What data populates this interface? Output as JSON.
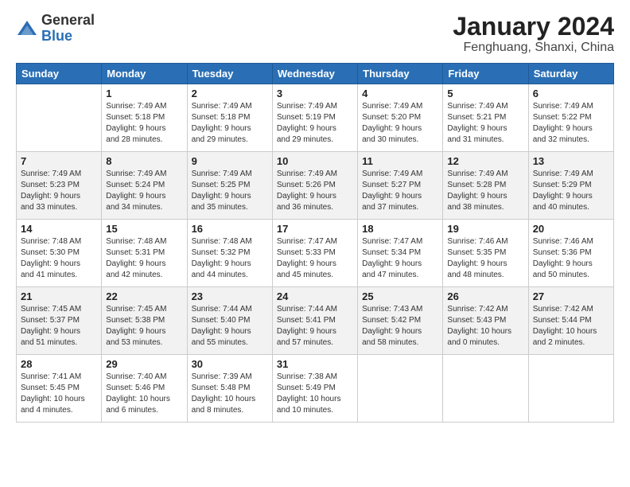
{
  "logo": {
    "general": "General",
    "blue": "Blue"
  },
  "title": {
    "month": "January 2024",
    "location": "Fenghuang, Shanxi, China"
  },
  "headers": [
    "Sunday",
    "Monday",
    "Tuesday",
    "Wednesday",
    "Thursday",
    "Friday",
    "Saturday"
  ],
  "weeks": [
    [
      {
        "day": "",
        "info": ""
      },
      {
        "day": "1",
        "info": "Sunrise: 7:49 AM\nSunset: 5:18 PM\nDaylight: 9 hours\nand 28 minutes."
      },
      {
        "day": "2",
        "info": "Sunrise: 7:49 AM\nSunset: 5:18 PM\nDaylight: 9 hours\nand 29 minutes."
      },
      {
        "day": "3",
        "info": "Sunrise: 7:49 AM\nSunset: 5:19 PM\nDaylight: 9 hours\nand 29 minutes."
      },
      {
        "day": "4",
        "info": "Sunrise: 7:49 AM\nSunset: 5:20 PM\nDaylight: 9 hours\nand 30 minutes."
      },
      {
        "day": "5",
        "info": "Sunrise: 7:49 AM\nSunset: 5:21 PM\nDaylight: 9 hours\nand 31 minutes."
      },
      {
        "day": "6",
        "info": "Sunrise: 7:49 AM\nSunset: 5:22 PM\nDaylight: 9 hours\nand 32 minutes."
      }
    ],
    [
      {
        "day": "7",
        "info": "Sunrise: 7:49 AM\nSunset: 5:23 PM\nDaylight: 9 hours\nand 33 minutes."
      },
      {
        "day": "8",
        "info": "Sunrise: 7:49 AM\nSunset: 5:24 PM\nDaylight: 9 hours\nand 34 minutes."
      },
      {
        "day": "9",
        "info": "Sunrise: 7:49 AM\nSunset: 5:25 PM\nDaylight: 9 hours\nand 35 minutes."
      },
      {
        "day": "10",
        "info": "Sunrise: 7:49 AM\nSunset: 5:26 PM\nDaylight: 9 hours\nand 36 minutes."
      },
      {
        "day": "11",
        "info": "Sunrise: 7:49 AM\nSunset: 5:27 PM\nDaylight: 9 hours\nand 37 minutes."
      },
      {
        "day": "12",
        "info": "Sunrise: 7:49 AM\nSunset: 5:28 PM\nDaylight: 9 hours\nand 38 minutes."
      },
      {
        "day": "13",
        "info": "Sunrise: 7:49 AM\nSunset: 5:29 PM\nDaylight: 9 hours\nand 40 minutes."
      }
    ],
    [
      {
        "day": "14",
        "info": "Sunrise: 7:48 AM\nSunset: 5:30 PM\nDaylight: 9 hours\nand 41 minutes."
      },
      {
        "day": "15",
        "info": "Sunrise: 7:48 AM\nSunset: 5:31 PM\nDaylight: 9 hours\nand 42 minutes."
      },
      {
        "day": "16",
        "info": "Sunrise: 7:48 AM\nSunset: 5:32 PM\nDaylight: 9 hours\nand 44 minutes."
      },
      {
        "day": "17",
        "info": "Sunrise: 7:47 AM\nSunset: 5:33 PM\nDaylight: 9 hours\nand 45 minutes."
      },
      {
        "day": "18",
        "info": "Sunrise: 7:47 AM\nSunset: 5:34 PM\nDaylight: 9 hours\nand 47 minutes."
      },
      {
        "day": "19",
        "info": "Sunrise: 7:46 AM\nSunset: 5:35 PM\nDaylight: 9 hours\nand 48 minutes."
      },
      {
        "day": "20",
        "info": "Sunrise: 7:46 AM\nSunset: 5:36 PM\nDaylight: 9 hours\nand 50 minutes."
      }
    ],
    [
      {
        "day": "21",
        "info": "Sunrise: 7:45 AM\nSunset: 5:37 PM\nDaylight: 9 hours\nand 51 minutes."
      },
      {
        "day": "22",
        "info": "Sunrise: 7:45 AM\nSunset: 5:38 PM\nDaylight: 9 hours\nand 53 minutes."
      },
      {
        "day": "23",
        "info": "Sunrise: 7:44 AM\nSunset: 5:40 PM\nDaylight: 9 hours\nand 55 minutes."
      },
      {
        "day": "24",
        "info": "Sunrise: 7:44 AM\nSunset: 5:41 PM\nDaylight: 9 hours\nand 57 minutes."
      },
      {
        "day": "25",
        "info": "Sunrise: 7:43 AM\nSunset: 5:42 PM\nDaylight: 9 hours\nand 58 minutes."
      },
      {
        "day": "26",
        "info": "Sunrise: 7:42 AM\nSunset: 5:43 PM\nDaylight: 10 hours\nand 0 minutes."
      },
      {
        "day": "27",
        "info": "Sunrise: 7:42 AM\nSunset: 5:44 PM\nDaylight: 10 hours\nand 2 minutes."
      }
    ],
    [
      {
        "day": "28",
        "info": "Sunrise: 7:41 AM\nSunset: 5:45 PM\nDaylight: 10 hours\nand 4 minutes."
      },
      {
        "day": "29",
        "info": "Sunrise: 7:40 AM\nSunset: 5:46 PM\nDaylight: 10 hours\nand 6 minutes."
      },
      {
        "day": "30",
        "info": "Sunrise: 7:39 AM\nSunset: 5:48 PM\nDaylight: 10 hours\nand 8 minutes."
      },
      {
        "day": "31",
        "info": "Sunrise: 7:38 AM\nSunset: 5:49 PM\nDaylight: 10 hours\nand 10 minutes."
      },
      {
        "day": "",
        "info": ""
      },
      {
        "day": "",
        "info": ""
      },
      {
        "day": "",
        "info": ""
      }
    ]
  ]
}
